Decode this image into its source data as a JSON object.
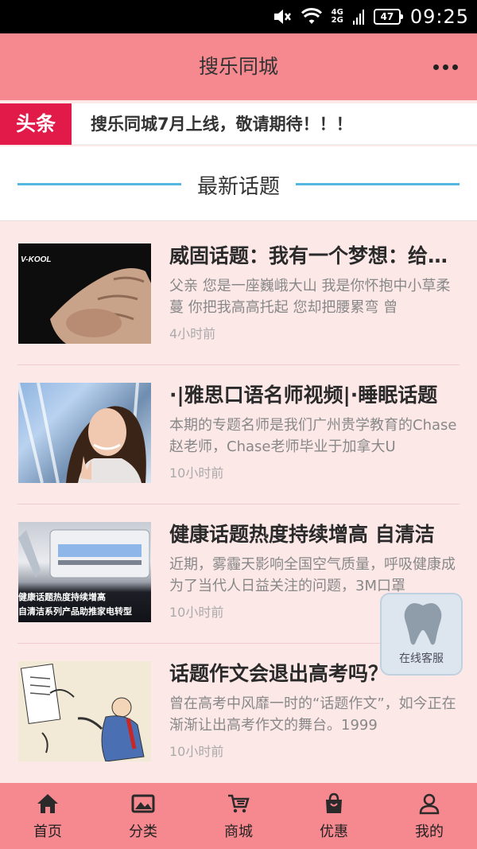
{
  "status_bar": {
    "network_top": "4G",
    "network_bottom": "2G",
    "battery": "47",
    "time": "09:25"
  },
  "header": {
    "title": "搜乐同城"
  },
  "ticker": {
    "badge": "头条",
    "text": "搜乐同城7月上线，敬请期待！！！"
  },
  "section": {
    "title": "最新话题"
  },
  "topics": [
    {
      "title": "威固话题：我有一个梦想：给爱一个家",
      "desc": "父亲 您是一座巍峨大山 我是你怀抱中小草柔蔓 你把我高高托起 您却把腰累弯 曾",
      "time": "4小时前",
      "thumb_brand": "V-KOOL"
    },
    {
      "title": "·|雅思口语名师视频|·睡眠话题",
      "desc": "本期的专题名师是我们广州贵学教育的Chase赵老师，Chase老师毕业于加拿大U",
      "time": "10小时前"
    },
    {
      "title": "健康话题热度持续增高 自清洁",
      "desc": "近期，雾霾天影响全国空气质量，呼吸健康成为了当代人日益关注的问题，3M口罩",
      "time": "10小时前",
      "thumb_caption_1": "健康话题热度持续增高",
      "thumb_caption_2": "自清洁系列产品助推家电转型"
    },
    {
      "title": "话题作文会退出高考吗？",
      "desc": "曾在高考中风靡一时的“话题作文”，如今正在渐渐让出高考作文的舞台。1999",
      "time": "10小时前"
    }
  ],
  "customer_service": {
    "label": "在线客服",
    "icon": "tooth-icon"
  },
  "bottom_nav": [
    {
      "label": "首页",
      "icon": "home-icon"
    },
    {
      "label": "分类",
      "icon": "gallery-icon"
    },
    {
      "label": "商城",
      "icon": "cart-icon"
    },
    {
      "label": "优惠",
      "icon": "shopping-bag-icon"
    },
    {
      "label": "我的",
      "icon": "user-icon"
    }
  ],
  "colors": {
    "header_bg": "#f6888f",
    "badge_bg": "#e21a4a",
    "accent_line": "#53b7e0",
    "page_bg": "#fde8e8"
  }
}
